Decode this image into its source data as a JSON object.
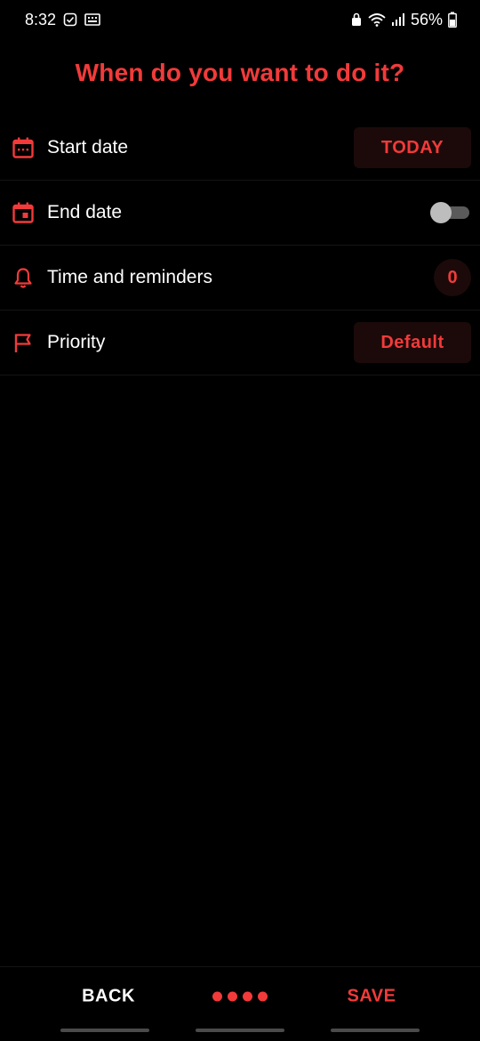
{
  "status_bar": {
    "time": "8:32",
    "battery": "56%",
    "icons_left": [
      "check-box-icon",
      "keyboard-icon"
    ],
    "icons_right": [
      "lock-icon",
      "wifi-icon",
      "signal-icon",
      "battery-icon"
    ]
  },
  "title": "When do you want to do it?",
  "rows": [
    {
      "icon": "calendar-icon",
      "label": "Start date",
      "value": "TODAY"
    },
    {
      "icon": "calendar-event-icon",
      "label": "End date",
      "toggle_on": false
    },
    {
      "icon": "bell-icon",
      "label": "Time and reminders",
      "value": "0"
    },
    {
      "icon": "flag-icon",
      "label": "Priority",
      "value": "Default"
    }
  ],
  "bottom_bar": {
    "back_label": "BACK",
    "save_label": "SAVE",
    "step_dots": 4
  },
  "colors": {
    "accent": "#f23a3a",
    "background": "#000000",
    "pill_background": "#1c0a0a",
    "text": "#ffffff"
  }
}
